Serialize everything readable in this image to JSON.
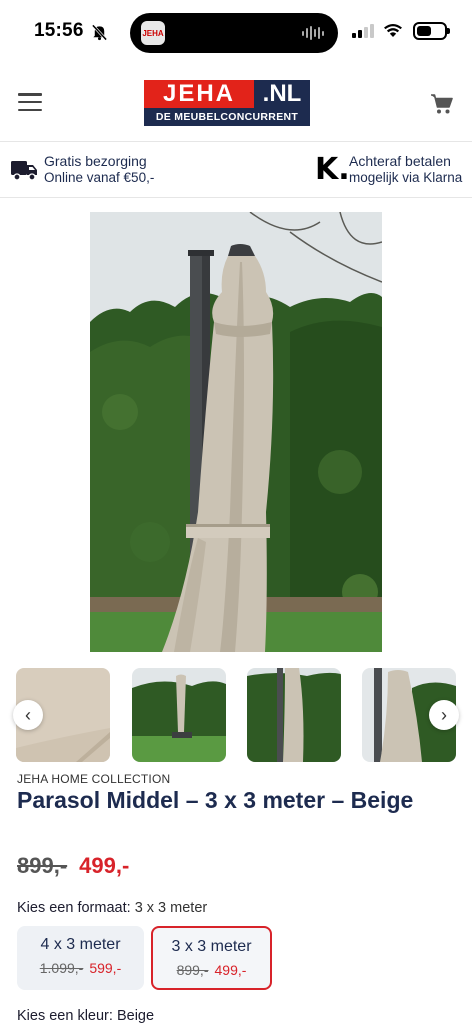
{
  "status_bar": {
    "time": "15:56",
    "battery_level": 0.55
  },
  "header": {
    "logo_main": "JEHA",
    "logo_suffix": ".NL",
    "logo_tagline": "DE MEUBELCONCURRENT",
    "menu_icon": "hamburger-icon",
    "cart_icon": "cart-icon"
  },
  "usp": {
    "left_title": "Gratis bezorging",
    "left_sub": "Online vanaf €50,-",
    "right_logo": "K.",
    "right_title": "Achteraf betalen",
    "right_sub": "mogelijk via Klarna"
  },
  "gallery": {
    "prev_label": "‹",
    "next_label": "›"
  },
  "product": {
    "brand": "JEHA HOME COLLECTION",
    "title": "Parasol Middel – 3 x 3 meter – Beige",
    "price_old": "899,-",
    "price_new": "499,-",
    "format_label": "Kies een formaat:",
    "format_value": "3 x 3 meter",
    "options": [
      {
        "name": "4 x 3 meter",
        "price_old": "1.099,-",
        "price_new": "599,-",
        "selected": false
      },
      {
        "name": "3 x 3 meter",
        "price_old": "899,-",
        "price_new": "499,-",
        "selected": true
      }
    ],
    "color_label": "Kies een kleur:",
    "color_value": "Beige"
  },
  "colors": {
    "brand_red": "#e2231a",
    "brand_navy": "#1d2b4f",
    "price_red": "#d8232a"
  }
}
